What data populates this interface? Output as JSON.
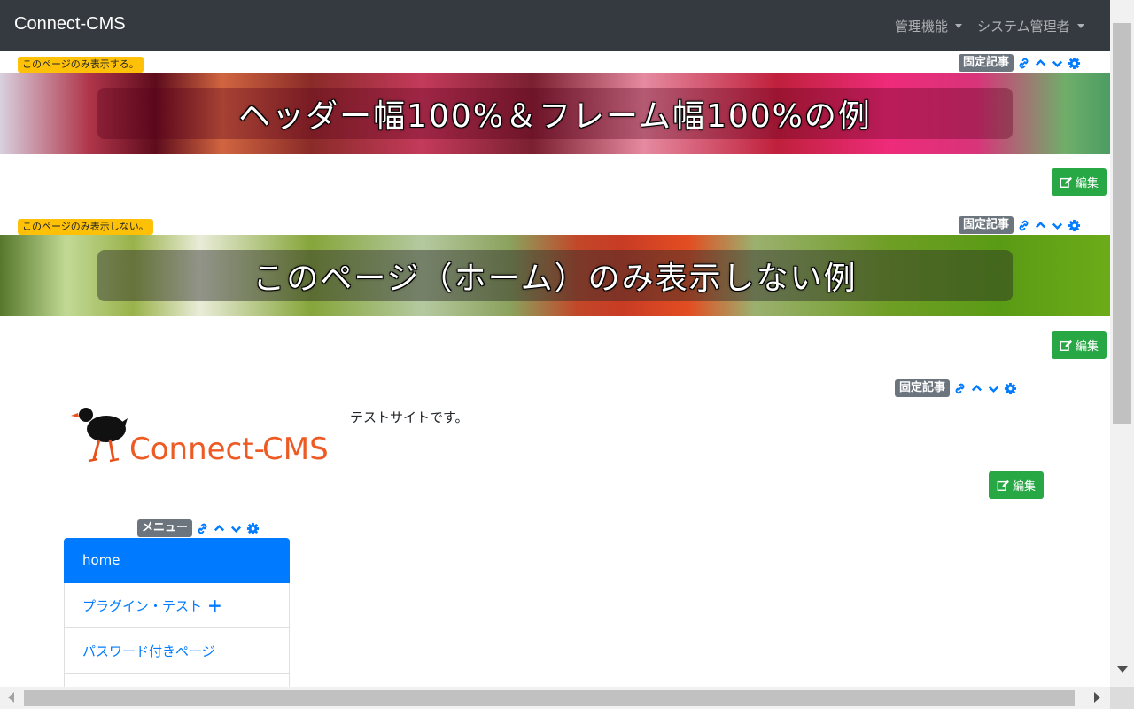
{
  "navbar": {
    "brand": "Connect-CMS",
    "items": [
      {
        "label": "管理機能"
      },
      {
        "label": "システム管理者"
      }
    ]
  },
  "frames": [
    {
      "visibility_label": "このページのみ表示する。",
      "type_label": "固定記事",
      "banner_text": "ヘッダー幅100%＆フレーム幅100%の例",
      "edit_label": "編集"
    },
    {
      "visibility_label": "このページのみ表示しない。",
      "type_label": "固定記事",
      "banner_text": "このページ（ホーム）のみ表示しない例",
      "edit_label": "編集"
    },
    {
      "type_label": "固定記事",
      "logo_text_1": "Connect-",
      "logo_text_2": "CMS",
      "body_text": "テストサイトです。",
      "edit_label": "編集"
    }
  ],
  "menu": {
    "type_label": "メニュー",
    "items": [
      {
        "label": "home",
        "active": true
      },
      {
        "label": "プラグイン・テスト",
        "has_children": true
      },
      {
        "label": "パスワード付きページ"
      },
      {
        "label": ""
      }
    ]
  },
  "colors": {
    "navbar": "#343a40",
    "primary": "#007bff",
    "success": "#28a745",
    "warning": "#ffc107",
    "secondary": "#6c757d",
    "logo_orange": "#ee5a24"
  }
}
